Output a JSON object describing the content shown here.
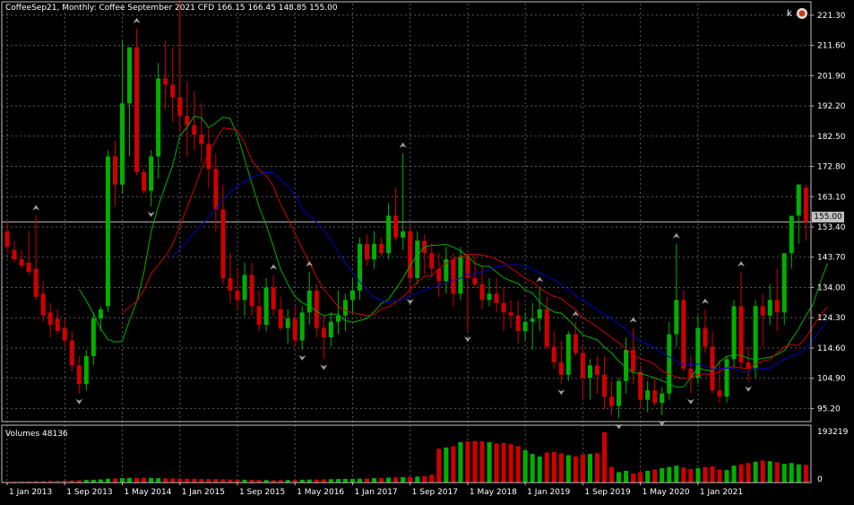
{
  "header": {
    "symbol_line": "CoffeeSep21, Monthly:  Coffee September 2021 CFD  166.15 166.45 148.85 155.00",
    "volume_label": "Volumes 48136"
  },
  "current_price_label": "155.00",
  "colors": {
    "background": "#000000",
    "grid": "#5a5a5a",
    "bull_candle": "#00b000",
    "bear_candle": "#d00000",
    "ma_fast": "#00b000",
    "ma_mid": "#d00000",
    "ma_slow": "#0000c8",
    "fractal": "#a0a0a0",
    "text": "#ffffff"
  },
  "chart_data": [
    {
      "type": "candlestick",
      "title": "CoffeeSep21, Monthly",
      "y_ticks": [
        "221.30",
        "211.60",
        "201.90",
        "192.20",
        "182.50",
        "172.80",
        "163.10",
        "153.40",
        "143.70",
        "134.00",
        "124.30",
        "114.60",
        "104.90",
        "95.20"
      ],
      "y_range": [
        91,
        225
      ],
      "x_ticks": [
        "1 Jan 2013",
        "1 Sep 2013",
        "1 May 2014",
        "1 Jan 2015",
        "1 Sep 2015",
        "1 May 2016",
        "1 Jan 2017",
        "1 Sep 2017",
        "1 May 2018",
        "1 Jan 2019",
        "1 Sep 2019",
        "1 May 2020",
        "1 Jan 2021"
      ],
      "current_price": 155.0,
      "ohlc": [
        [
          152,
          155,
          145,
          147
        ],
        [
          146,
          149,
          142,
          143
        ],
        [
          143,
          146,
          140,
          141
        ],
        [
          142,
          152,
          138,
          139
        ],
        [
          140,
          157,
          130,
          131
        ],
        [
          132,
          136,
          123,
          125
        ],
        [
          126,
          129,
          118,
          122
        ],
        [
          124,
          127,
          119,
          120
        ],
        [
          121,
          124,
          115,
          117
        ],
        [
          117,
          120,
          107,
          109
        ],
        [
          109,
          112,
          100,
          103
        ],
        [
          103,
          114,
          101,
          112
        ],
        [
          112,
          126,
          109,
          124
        ],
        [
          124,
          128,
          120,
          127
        ],
        [
          128,
          178,
          126,
          176
        ],
        [
          176,
          181,
          160,
          167
        ],
        [
          167,
          213,
          164,
          193
        ],
        [
          193,
          206,
          176,
          211
        ],
        [
          211,
          217,
          170,
          171
        ],
        [
          171,
          172,
          164,
          165
        ],
        [
          165,
          178,
          160,
          176
        ],
        [
          176,
          206,
          169,
          201
        ],
        [
          201,
          213,
          191,
          199
        ],
        [
          199,
          211,
          187,
          195
        ],
        [
          195,
          230,
          184,
          189
        ],
        [
          189,
          200,
          176,
          186
        ],
        [
          186,
          197,
          178,
          183
        ],
        [
          183,
          193,
          174,
          180
        ],
        [
          180,
          185,
          166,
          172
        ],
        [
          172,
          177,
          152,
          159
        ],
        [
          159,
          167,
          135,
          137
        ],
        [
          137,
          145,
          129,
          133
        ],
        [
          133,
          140,
          127,
          130
        ],
        [
          130,
          142,
          125,
          138
        ],
        [
          138,
          142,
          125,
          128
        ],
        [
          128,
          133,
          120,
          122
        ],
        [
          122,
          137,
          120,
          134
        ],
        [
          134,
          138,
          125,
          127
        ],
        [
          127,
          131,
          120,
          121
        ],
        [
          121,
          127,
          116,
          124
        ],
        [
          124,
          128,
          115,
          117
        ],
        [
          117,
          128,
          114,
          126
        ],
        [
          126,
          139,
          122,
          133
        ],
        [
          133,
          135,
          118,
          121
        ],
        [
          121,
          125,
          111,
          118
        ],
        [
          118,
          126,
          115,
          123
        ],
        [
          123,
          133,
          119,
          125
        ],
        [
          125,
          132,
          120,
          130
        ],
        [
          130,
          137,
          126,
          133
        ],
        [
          133,
          150,
          130,
          148
        ],
        [
          148,
          151,
          141,
          143
        ],
        [
          143,
          152,
          140,
          148
        ],
        [
          148,
          150,
          144,
          145
        ],
        [
          145,
          161,
          143,
          157
        ],
        [
          157,
          166,
          149,
          150
        ],
        [
          150,
          177,
          146,
          152
        ],
        [
          152,
          154,
          132,
          137
        ],
        [
          137,
          152,
          135,
          149
        ],
        [
          149,
          151,
          138,
          145
        ],
        [
          145,
          148,
          137,
          140
        ],
        [
          140,
          145,
          131,
          136
        ],
        [
          136,
          147,
          132,
          143
        ],
        [
          143,
          145,
          128,
          132
        ],
        [
          132,
          147,
          130,
          144
        ],
        [
          144,
          145,
          120,
          137
        ],
        [
          137,
          144,
          134,
          135
        ],
        [
          135,
          141,
          127,
          130
        ],
        [
          130,
          137,
          128,
          132
        ],
        [
          132,
          137,
          126,
          129
        ],
        [
          129,
          134,
          120,
          126
        ],
        [
          126,
          130,
          121,
          125
        ],
        [
          125,
          130,
          116,
          120
        ],
        [
          120,
          126,
          117,
          123
        ],
        [
          123,
          129,
          114,
          124
        ],
        [
          124,
          134,
          120,
          127
        ],
        [
          127,
          131,
          114,
          115
        ],
        [
          115,
          120,
          108,
          110
        ],
        [
          110,
          117,
          103,
          106
        ],
        [
          106,
          120,
          104,
          119
        ],
        [
          119,
          123,
          112,
          113
        ],
        [
          113,
          115,
          98,
          105
        ],
        [
          105,
          111,
          98,
          109
        ],
        [
          109,
          112,
          100,
          106
        ],
        [
          106,
          112,
          95,
          99
        ],
        [
          99,
          104,
          93,
          96
        ],
        [
          96,
          105,
          92,
          104
        ],
        [
          104,
          118,
          100,
          114
        ],
        [
          114,
          121,
          103,
          107
        ],
        [
          107,
          109,
          95,
          98
        ],
        [
          98,
          104,
          94,
          101
        ],
        [
          101,
          105,
          96,
          97
        ],
        [
          97,
          102,
          93,
          100
        ],
        [
          100,
          123,
          98,
          119
        ],
        [
          119,
          148,
          115,
          130
        ],
        [
          130,
          133,
          107,
          108
        ],
        [
          108,
          112,
          100,
          105
        ],
        [
          105,
          125,
          103,
          121
        ],
        [
          121,
          127,
          113,
          115
        ],
        [
          115,
          120,
          100,
          101
        ],
        [
          101,
          111,
          97,
          99
        ],
        [
          99,
          112,
          97,
          111
        ],
        [
          111,
          130,
          108,
          128
        ],
        [
          128,
          139,
          108,
          110
        ],
        [
          110,
          115,
          104,
          108
        ],
        [
          108,
          130,
          105,
          128
        ],
        [
          128,
          132,
          115,
          125
        ],
        [
          125,
          135,
          122,
          130
        ],
        [
          130,
          140,
          120,
          126
        ],
        [
          126,
          141,
          122,
          145
        ],
        [
          145,
          152,
          140,
          157
        ],
        [
          157,
          166,
          148,
          167
        ],
        [
          166,
          167,
          149,
          155
        ]
      ],
      "volume_ticks": [
        "193219",
        "0"
      ],
      "volume": [
        3000,
        4000,
        4200,
        4500,
        5000,
        5500,
        6000,
        6200,
        7000,
        8000,
        9000,
        10000,
        11000,
        12000,
        15000,
        16000,
        17000,
        18000,
        18500,
        19000,
        18000,
        17000,
        16500,
        16000,
        15500,
        15000,
        14500,
        14000,
        13500,
        13000,
        12500,
        12000,
        11500,
        11000,
        10500,
        10000,
        9500,
        9000,
        9500,
        10000,
        10500,
        11000,
        11500,
        12000,
        12500,
        13000,
        13500,
        14000,
        14500,
        15000,
        16000,
        17000,
        18000,
        19000,
        20000,
        21000,
        22000,
        23000,
        25000,
        30000,
        130000,
        135000,
        140000,
        155000,
        158000,
        160000,
        158000,
        155000,
        150000,
        152000,
        148000,
        140000,
        125000,
        110000,
        100000,
        115000,
        118000,
        112000,
        105000,
        100000,
        108000,
        110000,
        113000,
        193219,
        60000,
        40000,
        45000,
        35000,
        40000,
        45000,
        50000,
        55000,
        60000,
        65000,
        58000,
        52000,
        55000,
        60000,
        62000,
        50000,
        48000,
        65000,
        70000,
        75000,
        80000,
        85000,
        82000,
        78000,
        72000,
        75000,
        70000,
        68000
      ],
      "volume_range": [
        0,
        200000
      ],
      "indicators": [
        "moving-average-fast",
        "moving-average-mid",
        "moving-average-slow",
        "volumes"
      ]
    }
  ]
}
